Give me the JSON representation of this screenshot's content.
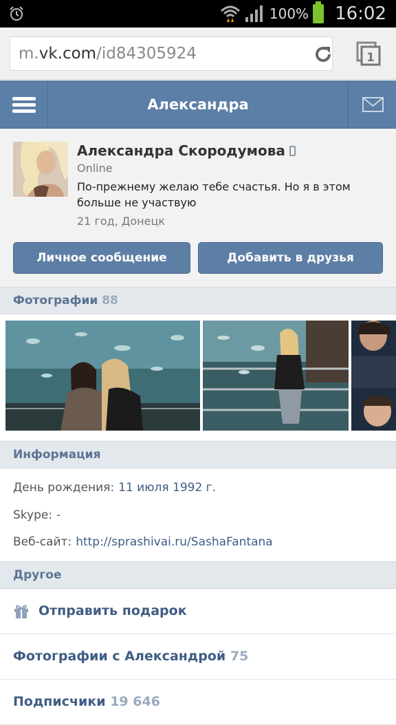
{
  "status_bar": {
    "battery": "100%",
    "time": "16:02"
  },
  "browser": {
    "url_prefix": "m.",
    "url_host": "vk.com",
    "url_path": "/id84305924",
    "tabs_count": "1"
  },
  "header": {
    "title": "Александра"
  },
  "profile": {
    "name": "Александра Скородумова",
    "online": "Online",
    "status": "По-прежнему желаю тебе счастья. Но я в этом больше не участвую",
    "meta": "21 год, Донецк",
    "btn_message": "Личное сообщение",
    "btn_add_friend": "Добавить в друзья"
  },
  "photos": {
    "title": "Фотографии",
    "count": "88"
  },
  "info": {
    "title": "Информация",
    "rows": [
      {
        "label": "День рождения:",
        "value": "11 июля 1992 г."
      },
      {
        "label": "Skype:",
        "value": "-"
      },
      {
        "label": "Веб-сайт:",
        "value": "http://sprashivai.ru/SashaFantana"
      }
    ]
  },
  "other": {
    "title": "Другое",
    "gift": "Отправить подарок",
    "photos_with": "Фотографии с Александрой",
    "photos_with_count": "75",
    "followers": "Подписчики",
    "followers_count": "19 646"
  },
  "colors": {
    "vk_blue": "#5b7fa6",
    "link": "#3f5d84",
    "section_bg": "#e3e8ed"
  }
}
